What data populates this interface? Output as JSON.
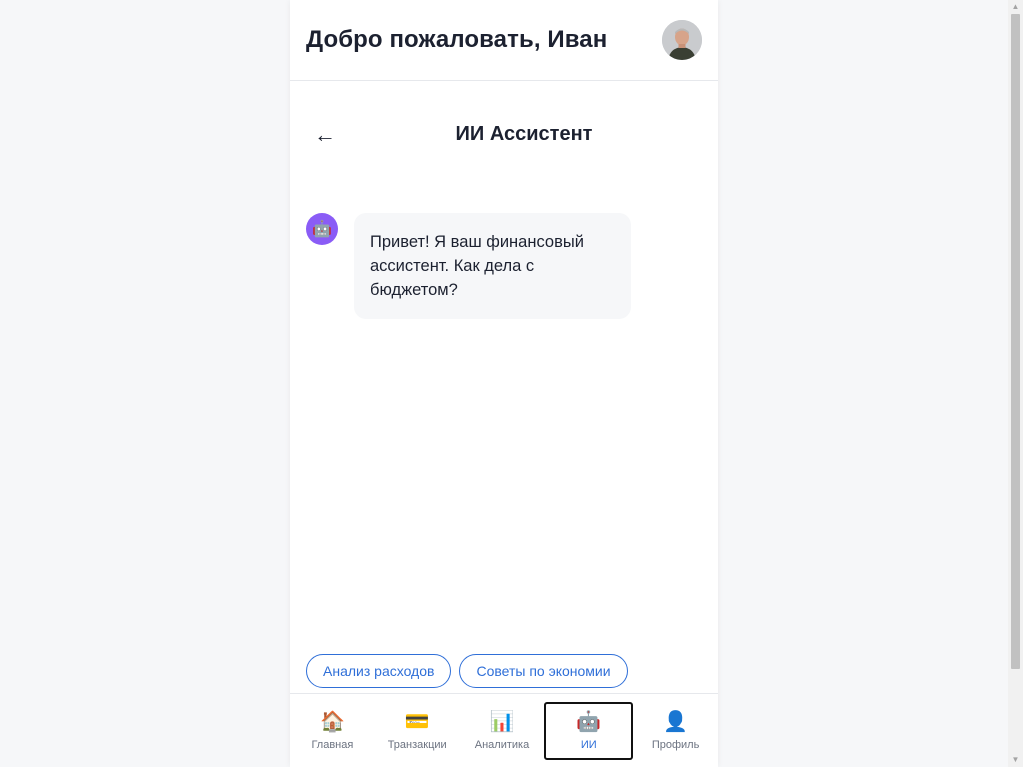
{
  "header": {
    "welcome": "Добро пожаловать, Иван",
    "avatar_icon": "user-photo-avatar"
  },
  "screen": {
    "back_icon": "←",
    "title": "ИИ Ассистент"
  },
  "chat": {
    "messages": [
      {
        "sender_icon": "🤖",
        "text": "Привет! Я ваш финансовый ассистент. Как дела с бюджетом?"
      }
    ]
  },
  "suggestions": [
    "Анализ расходов",
    "Советы по экономии"
  ],
  "nav": {
    "items": [
      {
        "icon": "🏠",
        "label": "Главная",
        "active": false
      },
      {
        "icon": "💳",
        "label": "Транзакции",
        "active": false
      },
      {
        "icon": "📊",
        "label": "Аналитика",
        "active": false
      },
      {
        "icon": "🤖",
        "label": "ИИ",
        "active": true
      },
      {
        "icon": "👤",
        "label": "Профиль",
        "active": false
      }
    ]
  },
  "colors": {
    "accent": "#2f6fd8",
    "bot_avatar": "#8a5cf6",
    "bubble": "#f6f7f9"
  }
}
